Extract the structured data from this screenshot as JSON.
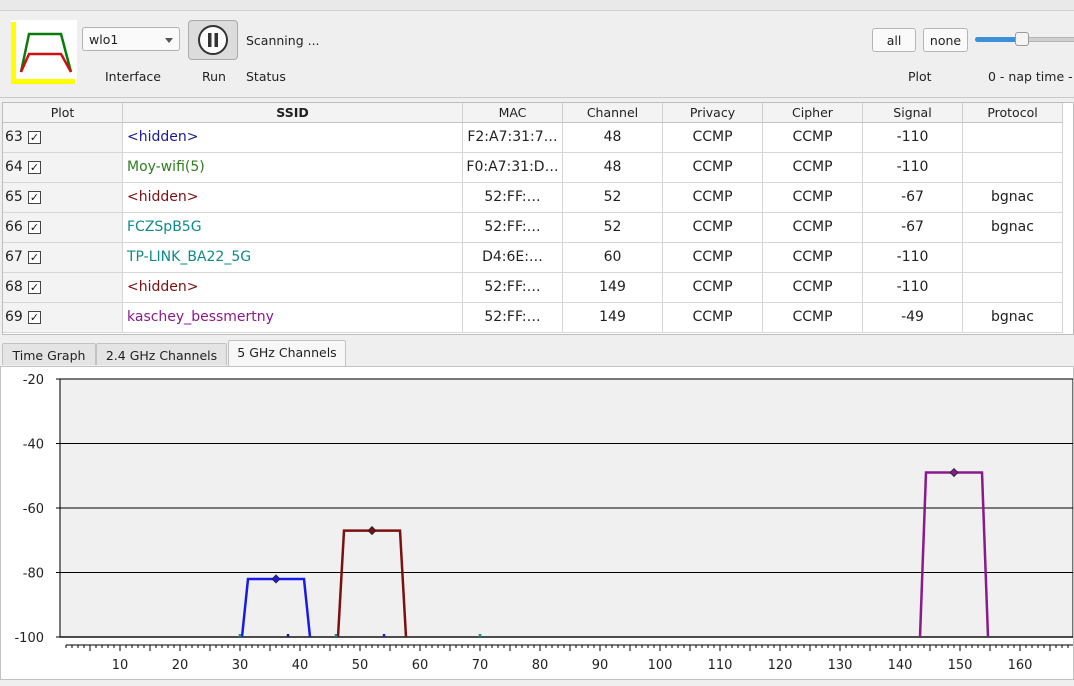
{
  "toolbar": {
    "interface_value": "wlo1",
    "interface_label": "Interface",
    "run_label": "Run",
    "status_text": "Scanning ...",
    "status_label": "Status",
    "plot_all": "all",
    "plot_none": "none",
    "plot_label": "Plot",
    "nap_text": "0 - nap time - ",
    "slider_value": 0
  },
  "table": {
    "columns": [
      "Plot",
      "SSID",
      "MAC",
      "Channel",
      "Privacy",
      "Cipher",
      "Signal",
      "Protocol"
    ],
    "rows": [
      {
        "num": "63",
        "checked": "✓",
        "ssid": "<hidden>",
        "ssid_color": "#1b1b8f",
        "mac": "F2:A7:31:7…",
        "channel": "48",
        "privacy": "CCMP",
        "cipher": "CCMP",
        "signal": "-110",
        "protocol": ""
      },
      {
        "num": "64",
        "checked": "✓",
        "ssid": "Moy-wifi(5)",
        "ssid_color": "#2f7d20",
        "mac": "F0:A7:31:D…",
        "channel": "48",
        "privacy": "CCMP",
        "cipher": "CCMP",
        "signal": "-110",
        "protocol": ""
      },
      {
        "num": "65",
        "checked": "✓",
        "ssid": "<hidden>",
        "ssid_color": "#7a1010",
        "mac": "52:FF:…",
        "channel": "52",
        "privacy": "CCMP",
        "cipher": "CCMP",
        "signal": "-67",
        "protocol": "bgnac"
      },
      {
        "num": "66",
        "checked": "✓",
        "ssid": "FCZSpB5G",
        "ssid_color": "#0f8a8a",
        "mac": "52:FF:…",
        "channel": "52",
        "privacy": "CCMP",
        "cipher": "CCMP",
        "signal": "-67",
        "protocol": "bgnac"
      },
      {
        "num": "67",
        "checked": "✓",
        "ssid": "TP-LINK_BA22_5G",
        "ssid_color": "#0f8a8a",
        "mac": "D4:6E:…",
        "channel": "60",
        "privacy": "CCMP",
        "cipher": "CCMP",
        "signal": "-110",
        "protocol": ""
      },
      {
        "num": "68",
        "checked": "✓",
        "ssid": "<hidden>",
        "ssid_color": "#7a1010",
        "mac": "52:FF:…",
        "channel": "149",
        "privacy": "CCMP",
        "cipher": "CCMP",
        "signal": "-110",
        "protocol": ""
      },
      {
        "num": "69",
        "checked": "✓",
        "ssid": "kaschey_bessmertny",
        "ssid_color": "#8a1a8a",
        "mac": "52:FF:…",
        "channel": "149",
        "privacy": "CCMP",
        "cipher": "CCMP",
        "signal": "-49",
        "protocol": "bgnac"
      }
    ]
  },
  "tabs": [
    "Time Graph",
    "2.4 GHz Channels",
    "5 GHz Channels"
  ],
  "active_tab": "5 GHz Channels",
  "chart_data": {
    "type": "line",
    "title": "",
    "xlabel": "",
    "ylabel": "",
    "xlim": [
      0,
      168
    ],
    "ylim": [
      -100,
      -20
    ],
    "y_ticks": [
      "-20",
      "-40",
      "-60",
      "-80",
      "-100"
    ],
    "x_ticks": [
      "10",
      "20",
      "30",
      "40",
      "50",
      "60",
      "70",
      "80",
      "90",
      "100",
      "110",
      "120",
      "130",
      "140",
      "150",
      "160"
    ],
    "grid": "horizontal",
    "series": [
      {
        "color": "#1a1ae6",
        "center": 36,
        "signal": -82,
        "shape": "trapezoid"
      },
      {
        "color": "#7a1010",
        "center": 52,
        "signal": -67,
        "shape": "trapezoid"
      },
      {
        "color": "#8a1a8a",
        "center": 149,
        "signal": -49,
        "shape": "trapezoid"
      }
    ],
    "baseline_markers": [
      {
        "x": 30,
        "color": "#0f8a8a"
      },
      {
        "x": 38,
        "color": "#1a1a8f"
      },
      {
        "x": 46,
        "color": "#0f8a8a"
      },
      {
        "x": 54,
        "color": "#1a1ae6"
      },
      {
        "x": 70,
        "color": "#0f8a8a"
      }
    ]
  }
}
